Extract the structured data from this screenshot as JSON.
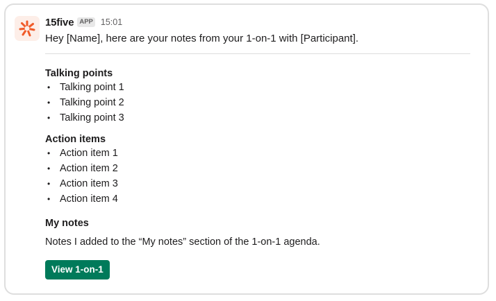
{
  "message": {
    "app_name": "15five",
    "app_badge": "APP",
    "timestamp": "15:01",
    "intro_text": "Hey [Name], here are your notes from your 1-on-1 with [Participant]."
  },
  "talking_points": {
    "heading": "Talking points",
    "items": [
      "Talking point 1",
      "Talking point 2",
      "Talking point 3"
    ]
  },
  "action_items": {
    "heading": "Action items",
    "items": [
      "Action item 1",
      "Action item 2",
      "Action item 3",
      "Action item 4"
    ]
  },
  "my_notes": {
    "heading": "My notes",
    "text": "Notes I added to the “My notes” section of the 1-on-1 agenda."
  },
  "button": {
    "label": "View 1-on-1"
  },
  "icons": {
    "avatar": "15five-logo-icon"
  },
  "colors": {
    "brand_accent": "#f05a28",
    "button_bg": "#007a5a"
  }
}
